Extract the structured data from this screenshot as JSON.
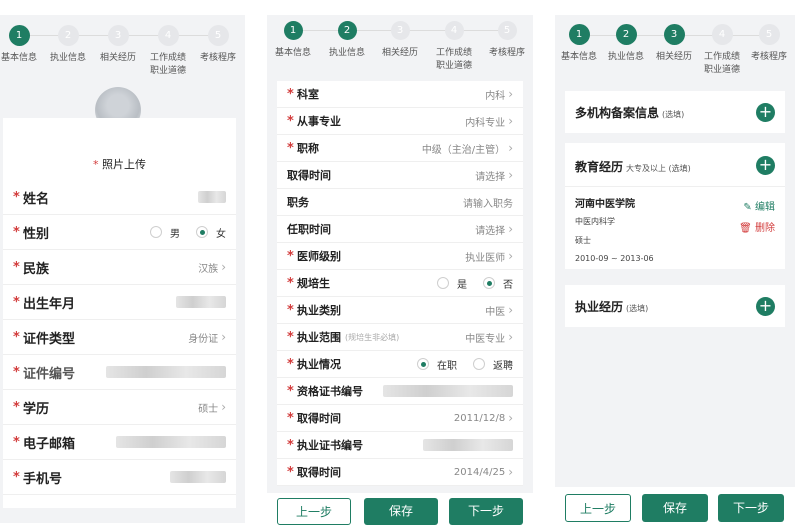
{
  "steps": [
    "基本信息",
    "执业信息",
    "相关经历",
    "工作成绩职业道德",
    "考核程序"
  ],
  "panel1": {
    "photo_label": "照片上传",
    "fields": [
      {
        "label": "姓名",
        "required": true,
        "value": ""
      },
      {
        "label": "性别",
        "required": true,
        "options": [
          "男",
          "女"
        ],
        "selected": "女"
      },
      {
        "label": "民族",
        "required": true,
        "value": "汉族"
      },
      {
        "label": "出生年月",
        "required": true,
        "value": ""
      },
      {
        "label": "证件类型",
        "required": true,
        "value": "身份证"
      },
      {
        "label": "证件编号",
        "required": true,
        "value": ""
      },
      {
        "label": "学历",
        "required": true,
        "value": "硕士"
      },
      {
        "label": "电子邮箱",
        "required": true,
        "value": ""
      },
      {
        "label": "手机号",
        "required": true,
        "value": ""
      }
    ]
  },
  "panel2": {
    "fields": [
      {
        "label": "科室",
        "required": true,
        "value": "内科"
      },
      {
        "label": "从事专业",
        "required": true,
        "value": "内科专业"
      },
      {
        "label": "职称",
        "required": true,
        "value": "中级（主治/主管）"
      },
      {
        "label": "取得时间",
        "required": false,
        "value": "请选择"
      },
      {
        "label": "职务",
        "required": false,
        "value": "请输入职务"
      },
      {
        "label": "任职时间",
        "required": false,
        "value": "请选择"
      },
      {
        "label": "医师级别",
        "required": true,
        "value": "执业医师"
      },
      {
        "label": "规培生",
        "required": true,
        "options": [
          "是",
          "否"
        ],
        "selected": "否"
      },
      {
        "label": "执业类别",
        "required": true,
        "value": "中医"
      },
      {
        "label": "执业范围",
        "required": true,
        "hint": "(规培生非必填)",
        "value": "中医专业"
      },
      {
        "label": "执业情况",
        "required": true,
        "options": [
          "在职",
          "返聘"
        ],
        "selected": "在职"
      },
      {
        "label": "资格证书编号",
        "required": true,
        "value": ""
      },
      {
        "label": "取得时间",
        "required": true,
        "value": "2011/12/8"
      },
      {
        "label": "执业证书编号",
        "required": true,
        "value": ""
      },
      {
        "label": "取得时间",
        "required": true,
        "value": "2014/4/25"
      }
    ],
    "buttons": {
      "prev": "上一步",
      "save": "保存",
      "next": "下一步"
    }
  },
  "panel3": {
    "sections": [
      {
        "title": "多机构备案信息",
        "note": "(选填)"
      },
      {
        "title": "教育经历",
        "note": "大专及以上 (选填)"
      },
      {
        "title": "执业经历",
        "note": "(选填)"
      }
    ],
    "education": {
      "school": "河南中医学院",
      "major": "中医内科学",
      "degree": "硕士",
      "period": "2010-09 ~ 2013-06",
      "edit": "编辑",
      "delete": "删除"
    },
    "buttons": {
      "prev": "上一步",
      "save": "保存",
      "next": "下一步"
    }
  },
  "colors": {
    "accent": "#1f7d63",
    "required": "#d23b3b"
  }
}
